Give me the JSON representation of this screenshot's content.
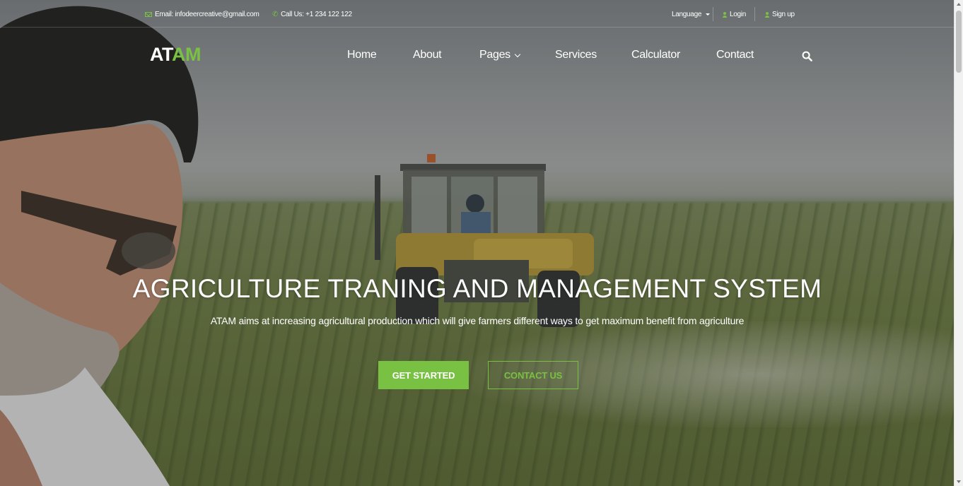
{
  "topbar": {
    "email_text": "Email: infodeercreative@gmail.com",
    "phone_text": "Call Us: +1 234 122 122",
    "language_label": "Language",
    "login_label": "Login",
    "signup_label": "Sign up"
  },
  "brand": {
    "logo_part1": "AT",
    "logo_part2": "AM"
  },
  "nav": {
    "home": "Home",
    "about": "About",
    "pages": "Pages",
    "services": "Services",
    "calculator": "Calculator",
    "contact": "Contact"
  },
  "hero": {
    "title": "AGRICULTURE TRANING AND MANAGEMENT SYSTEM",
    "subtitle": "ATAM aims at increasing agricultural production which will give farmers different ways to get maximum benefit from agriculture",
    "primary_button": "GET STARTED",
    "secondary_button": "CONTACT US"
  },
  "colors": {
    "accent": "#79c142",
    "text": "#ffffff"
  },
  "icons": {
    "email": "envelope-icon",
    "phone": "phone-icon",
    "user": "user-icon",
    "search": "search-icon",
    "dropdown": "chevron-down-icon"
  }
}
